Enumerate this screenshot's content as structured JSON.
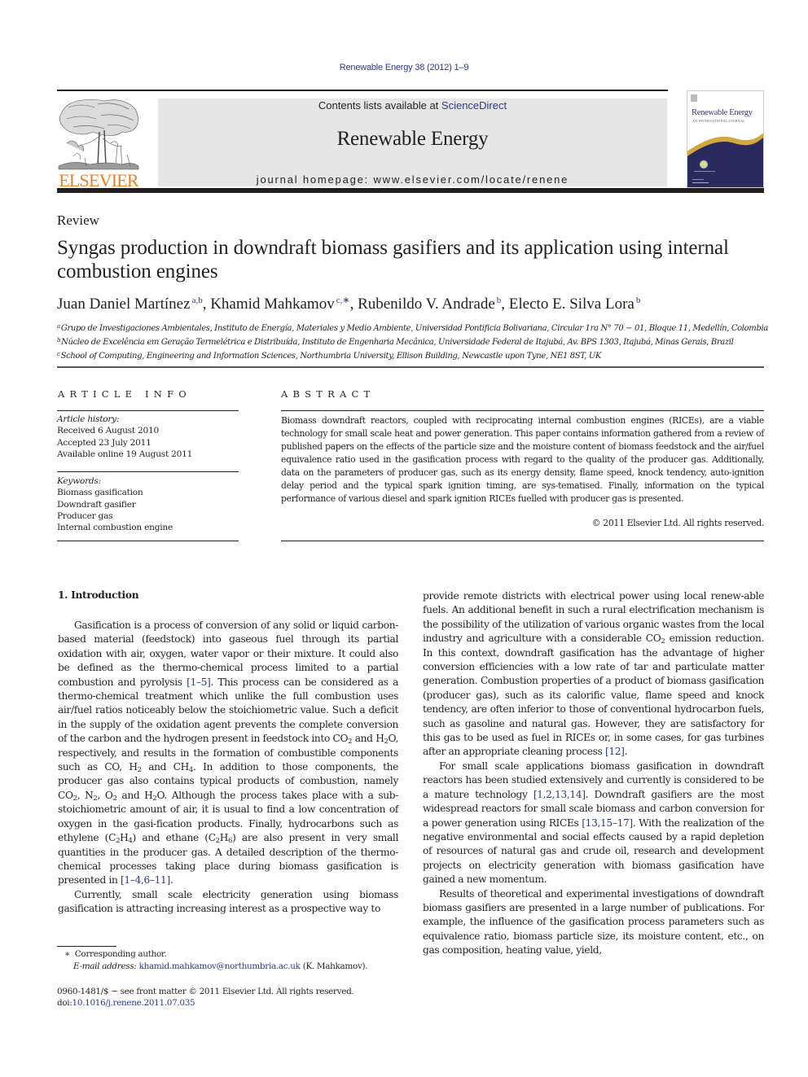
{
  "running_head": "Renewable Energy 38 (2012) 1–9",
  "masthead": {
    "contents_prefix": "Contents lists available at ",
    "contents_link": "ScienceDirect",
    "journal_name": "Renewable Energy",
    "homepage": "journal homepage: www.elsevier.com/locate/renene"
  },
  "publisher_logo": "ELSEVIER",
  "cover": {
    "title": "Renewable Energy",
    "subtitle": "AN INTERNATIONAL JOURNAL"
  },
  "colors": {
    "link": "#2b3a8f",
    "elsevier_orange": "#f07f1f",
    "masthead_gray": "#e6e6e6",
    "cover_navy": "#2a2a5e",
    "cover_gold": "#d4a93c"
  },
  "article": {
    "section_type": "Review",
    "title": "Syngas production in downdraft biomass gasifiers and its application using internal combustion engines",
    "authors": [
      {
        "name": "Juan Daniel Martínez",
        "sup": "a,b"
      },
      {
        "name": "Khamid Mahkamov",
        "sup": "c,∗"
      },
      {
        "name": "Rubenildo V. Andrade",
        "sup": "b"
      },
      {
        "name": "Electo E. Silva Lora",
        "sup": "b"
      }
    ],
    "affiliations": [
      {
        "key": "a",
        "text": "Grupo de Investigaciones Ambientales, Instituto de Energía, Materiales y Medio Ambiente, Universidad Pontificia Bolivariana, Circular 1ra N° 70 − 01, Bloque 11, Medellín, Colombia"
      },
      {
        "key": "b",
        "text": "Núcleo de Excelência em Geração Termelétrica e Distribuída, Instituto de Engenharia Mecânica, Universidade Federal de Itajubá, Av. BPS 1303, Itajubá, Minas Gerais, Brazil"
      },
      {
        "key": "c",
        "text": "School of Computing, Engineering and Information Sciences, Northumbria University, Ellison Building, Newcastle upon Tyne, NE1 8ST, UK"
      }
    ]
  },
  "article_info": {
    "heading": "ARTICLE INFO",
    "history_label": "Article history:",
    "history": [
      "Received 6 August 2010",
      "Accepted 23 July 2011",
      "Available online 19 August 2011"
    ],
    "keywords_label": "Keywords:",
    "keywords": [
      "Biomass gasification",
      "Downdraft gasifier",
      "Producer gas",
      "Internal combustion engine"
    ]
  },
  "abstract": {
    "heading": "ABSTRACT",
    "text": "Biomass downdraft reactors, coupled with reciprocating internal combustion engines (RICEs), are a viable technology for small scale heat and power generation. This paper contains information gathered from a review of published papers on the effects of the particle size and the moisture content of biomass feedstock and the air/fuel equivalence ratio used in the gasification process with regard to the quality of the producer gas. Additionally, data on the parameters of producer gas, such as its energy density, flame speed, knock tendency, auto-ignition delay period and the typical spark ignition timing, are sys-tematised. Finally, information on the typical performance of various diesel and spark ignition RICEs fuelled with producer gas is presented.",
    "copyright": "© 2011 Elsevier Ltd. All rights reserved."
  },
  "body": {
    "section_heading": "1.  Introduction",
    "left_p1": [
      "Gasification is a process of conversion of any solid or liquid carbon-based material (feedstock) into gaseous fuel through its partial oxidation with air, oxygen, water vapor or their mixture. It could also be defined as the thermo-chemical process limited to a partial combustion and pyrolysis ",
      "[1–5]",
      ". This process can be considered as a thermo-chemical treatment which unlike the full combustion uses air/fuel ratios noticeably below the stoichiometric value. Such a deficit in the supply of the oxidation agent prevents the complete conversion of the carbon and the hydrogen present in feedstock into CO",
      "2",
      " and H",
      "2",
      "O, respectively, and results in the formation of combustible components such as CO, H",
      "2",
      " and CH",
      "4",
      ". In addition to those components, the producer gas also contains typical products of combustion, namely CO",
      "2",
      ", N",
      "2",
      ", O",
      "2",
      " and H",
      "2",
      "O. Although the process takes place with a sub-stoichiometric amount of air, it is usual to find a low concentration of oxygen in the gasi-fication products. Finally, hydrocarbons such as ethylene (C",
      "2",
      "H",
      "4",
      ") and ethane (C",
      "2",
      "H",
      "6",
      ") are also present in very small quantities in the producer gas. A detailed description of the thermo-chemical processes taking place during biomass gasification is presented in ",
      "[1–4,6–11]",
      "."
    ],
    "left_p2": "Currently, small scale electricity generation using biomass gasification is attracting increasing interest as a prospective way to",
    "right_p1": [
      "provide remote districts with electrical power using local renew-able fuels. An additional benefit in such a rural electrification mechanism is the possibility of the utilization of various organic wastes from the local industry and agriculture with a considerable CO",
      "2",
      " emission reduction. In this context, downdraft gasification has the advantage of higher conversion efficiencies with a low rate of tar and particulate matter generation. Combustion properties of a product of biomass gasification (producer gas), such as its calorific value, flame speed and knock tendency, are often inferior to those of conventional hydrocarbon fuels, such as gasoline and natural gas. However, they are satisfactory for this gas to be used as fuel in RICEs or, in some cases, for gas turbines after an appropriate cleaning process ",
      "[12]",
      "."
    ],
    "right_p2": [
      "For small scale applications biomass gasification in downdraft reactors has been studied extensively and currently is considered to be a mature technology ",
      "[1,2,13,14]",
      ". Downdraft gasifiers are the most widespread reactors for small scale biomass and carbon conversion for a power generation using RICEs ",
      "[13,15–17]",
      ". With the realization of the negative environmental and social effects caused by a rapid depletion of resources of natural gas and crude oil, research and development projects on electricity generation with biomass gasification have gained a new momentum."
    ],
    "right_p3": "Results of theoretical and experimental investigations of downdraft biomass gasifiers are presented in a large number of publications. For example, the influence of the gasification process parameters such as equivalence ratio, biomass particle size, its moisture content, etc., on gas composition, heating value, yield,"
  },
  "footnotes": {
    "corresponding_mark": "∗",
    "corresponding": "Corresponding author.",
    "email_label": "E-mail address:",
    "email": "khamid.mahkamov@northumbria.ac.uk",
    "email_owner": " (K. Mahkamov).",
    "issn_line": "0960-1481/$ − see front matter © 2011 Elsevier Ltd. All rights reserved.",
    "doi_label": "doi:",
    "doi": "10.1016/j.renene.2011.07.035"
  }
}
